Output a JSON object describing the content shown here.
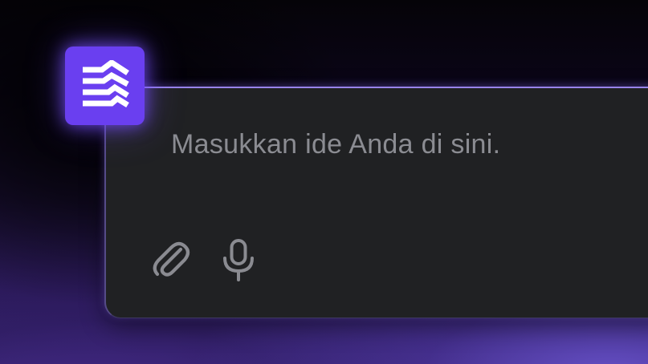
{
  "input": {
    "placeholder": "Masukkan ide Anda di sini."
  },
  "toolbar": {
    "attach_icon": "paperclip-icon",
    "mic_icon": "microphone-icon"
  },
  "logo": {
    "icon": "layered-waves-logo-icon"
  },
  "colors": {
    "accent": "#6a3ff0",
    "card_background": "#202123",
    "placeholder_text": "#8b8c92",
    "icon_color": "#8a8b91",
    "glow": "#a58eff"
  }
}
